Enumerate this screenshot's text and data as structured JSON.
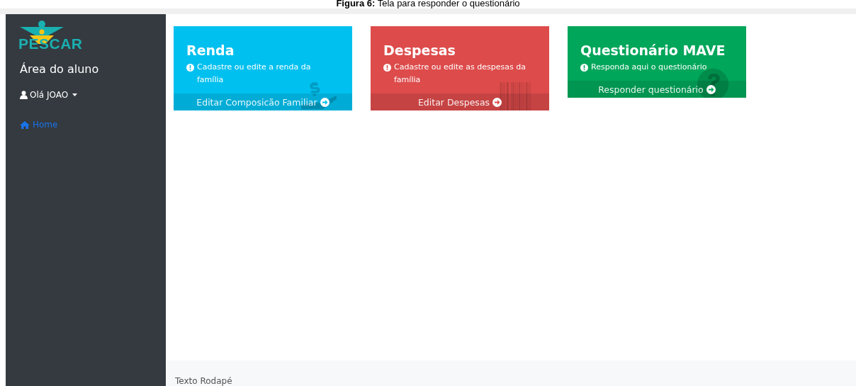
{
  "caption": "**Figura 6:** Tela para responder o questionário",
  "sidebar": {
    "logo": "PESCAR",
    "title": "Área do aluno",
    "user_menu": "Olá JOAO",
    "nav": [
      {
        "label": "Home",
        "selected": true
      }
    ]
  },
  "cards": [
    {
      "title": "Renda",
      "text": "Cadastre ou edite a renda da família",
      "link": "Editar Composicão Familiar",
      "color": "#00c0ef"
    },
    {
      "title": "Despesas",
      "text": "Cadastre ou edite as despesas da família",
      "link": "Editar Despesas",
      "color": "#dd4b4b"
    },
    {
      "title": "Questionário MAVE",
      "text": "Responda aqui o questionário",
      "link": "Responder questionário",
      "color": "#00a65a"
    }
  ],
  "footer": "Texto Rodapé"
}
